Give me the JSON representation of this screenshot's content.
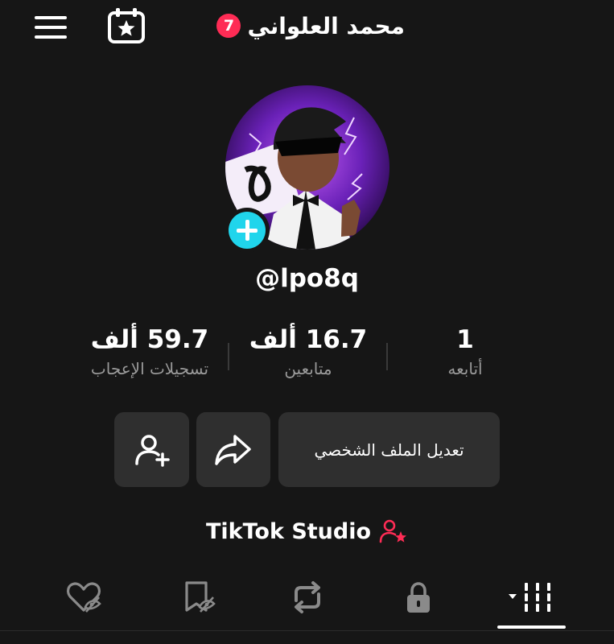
{
  "header": {
    "username": "محمد العلواني",
    "notification_count": "7",
    "menu_icon": "hamburger-menu-icon",
    "calendar_icon": "calendar-star-icon"
  },
  "profile": {
    "handle": "@lpo8q",
    "avatar": "cartoon-boy-with-sunglasses-avatar",
    "add_icon": "plus-icon",
    "accent_color": "#20d5ec",
    "badge_color": "#fe2c55"
  },
  "stats": {
    "following": {
      "value": "1",
      "label": "أتابعه"
    },
    "followers": {
      "value": "16.7",
      "unit": "ألف",
      "label": "متابعين"
    },
    "likes": {
      "value": "59.7",
      "unit": "ألف",
      "label": "تسجيلات الإعجاب"
    }
  },
  "actions": {
    "edit_profile_label": "تعديل الملف الشخصي",
    "share_icon": "share-arrow-icon",
    "add_friend_icon": "add-friend-icon"
  },
  "studio": {
    "label": "TikTok Studio",
    "icon": "user-star-icon"
  },
  "tabs": [
    {
      "name": "videos",
      "icon": "grid-bars-icon",
      "selected": true
    },
    {
      "name": "private",
      "icon": "lock-icon",
      "selected": false
    },
    {
      "name": "reposts",
      "icon": "repost-icon",
      "selected": false
    },
    {
      "name": "favorites",
      "icon": "bookmark-hidden-icon",
      "selected": false
    },
    {
      "name": "liked",
      "icon": "heart-hidden-icon",
      "selected": false
    }
  ]
}
